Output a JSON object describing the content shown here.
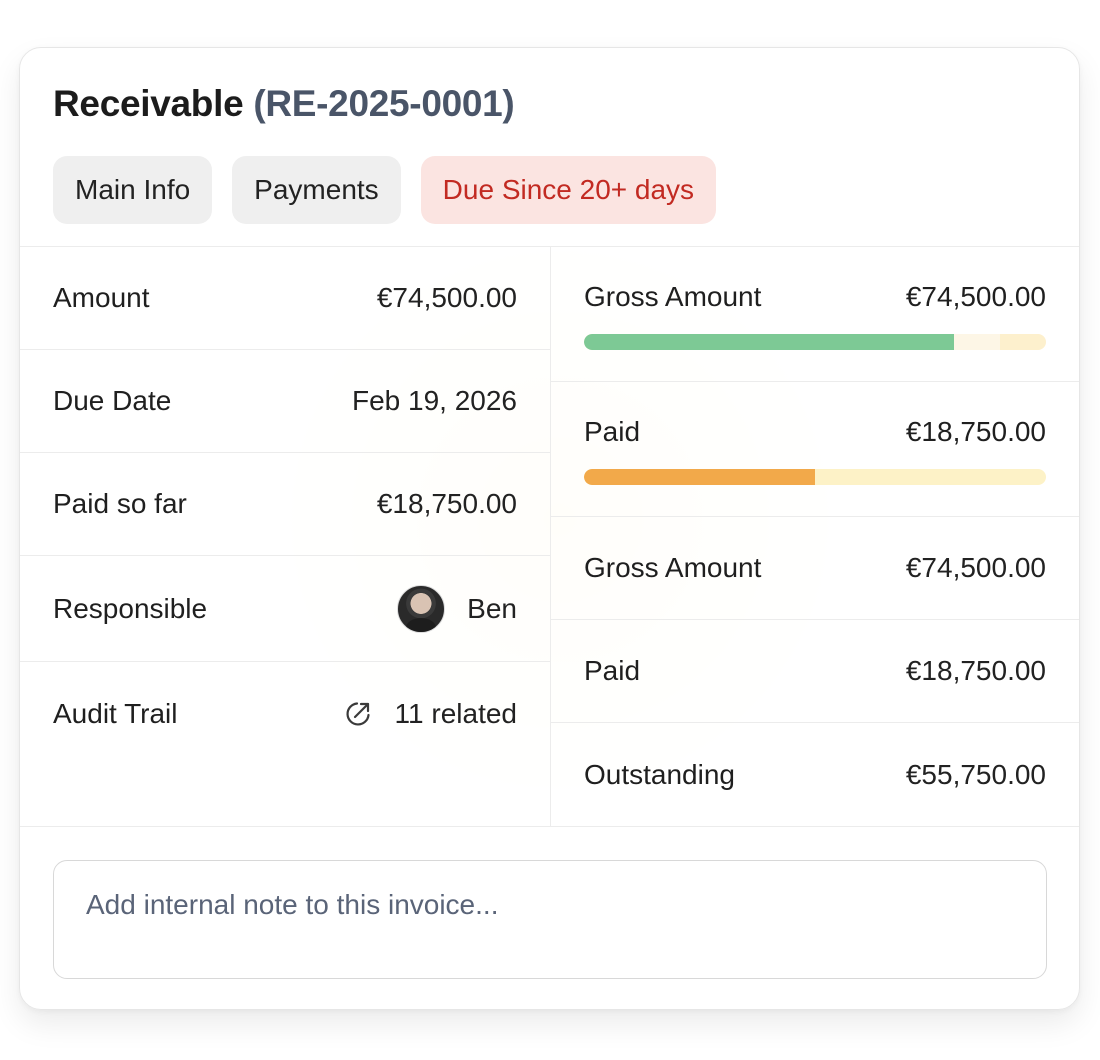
{
  "header": {
    "title": "Receivable",
    "reference": "(RE-2025-0001)",
    "tabs": [
      {
        "label": "Main Info"
      },
      {
        "label": "Payments"
      },
      {
        "label": "Due Since 20+ days"
      }
    ]
  },
  "details": {
    "amount": {
      "label": "Amount",
      "value": "€74,500.00"
    },
    "due_date": {
      "label": "Due Date",
      "value": "Feb 19, 2026"
    },
    "paid_so_far": {
      "label": "Paid so far",
      "value": "€18,750.00"
    },
    "responsible": {
      "label": "Responsible",
      "name": "Ben"
    },
    "audit_trail": {
      "label": "Audit Trail",
      "value": "11 related",
      "icon": "external-link-icon"
    }
  },
  "summary": {
    "gross_bar": {
      "label": "Gross Amount",
      "value": "€74,500.00",
      "fill_fraction": 0.8,
      "secondary_fraction": 0.1,
      "fill_color": "#7dc995"
    },
    "paid_bar": {
      "label": "Paid",
      "value": "€18,750.00",
      "fill_fraction": 0.5,
      "fill_color": "#f2a94a"
    },
    "gross_amount": {
      "label": "Gross Amount",
      "value": "€74,500.00"
    },
    "paid": {
      "label": "Paid",
      "value": "€18,750.00"
    },
    "outstanding": {
      "label": "Outstanding",
      "value": "€55,750.00"
    }
  },
  "note": {
    "placeholder": "Add internal note to this invoice..."
  },
  "colors": {
    "alert_text": "#c22a22",
    "alert_bg": "#fbe4e1",
    "reference_text": "#4a5568"
  }
}
